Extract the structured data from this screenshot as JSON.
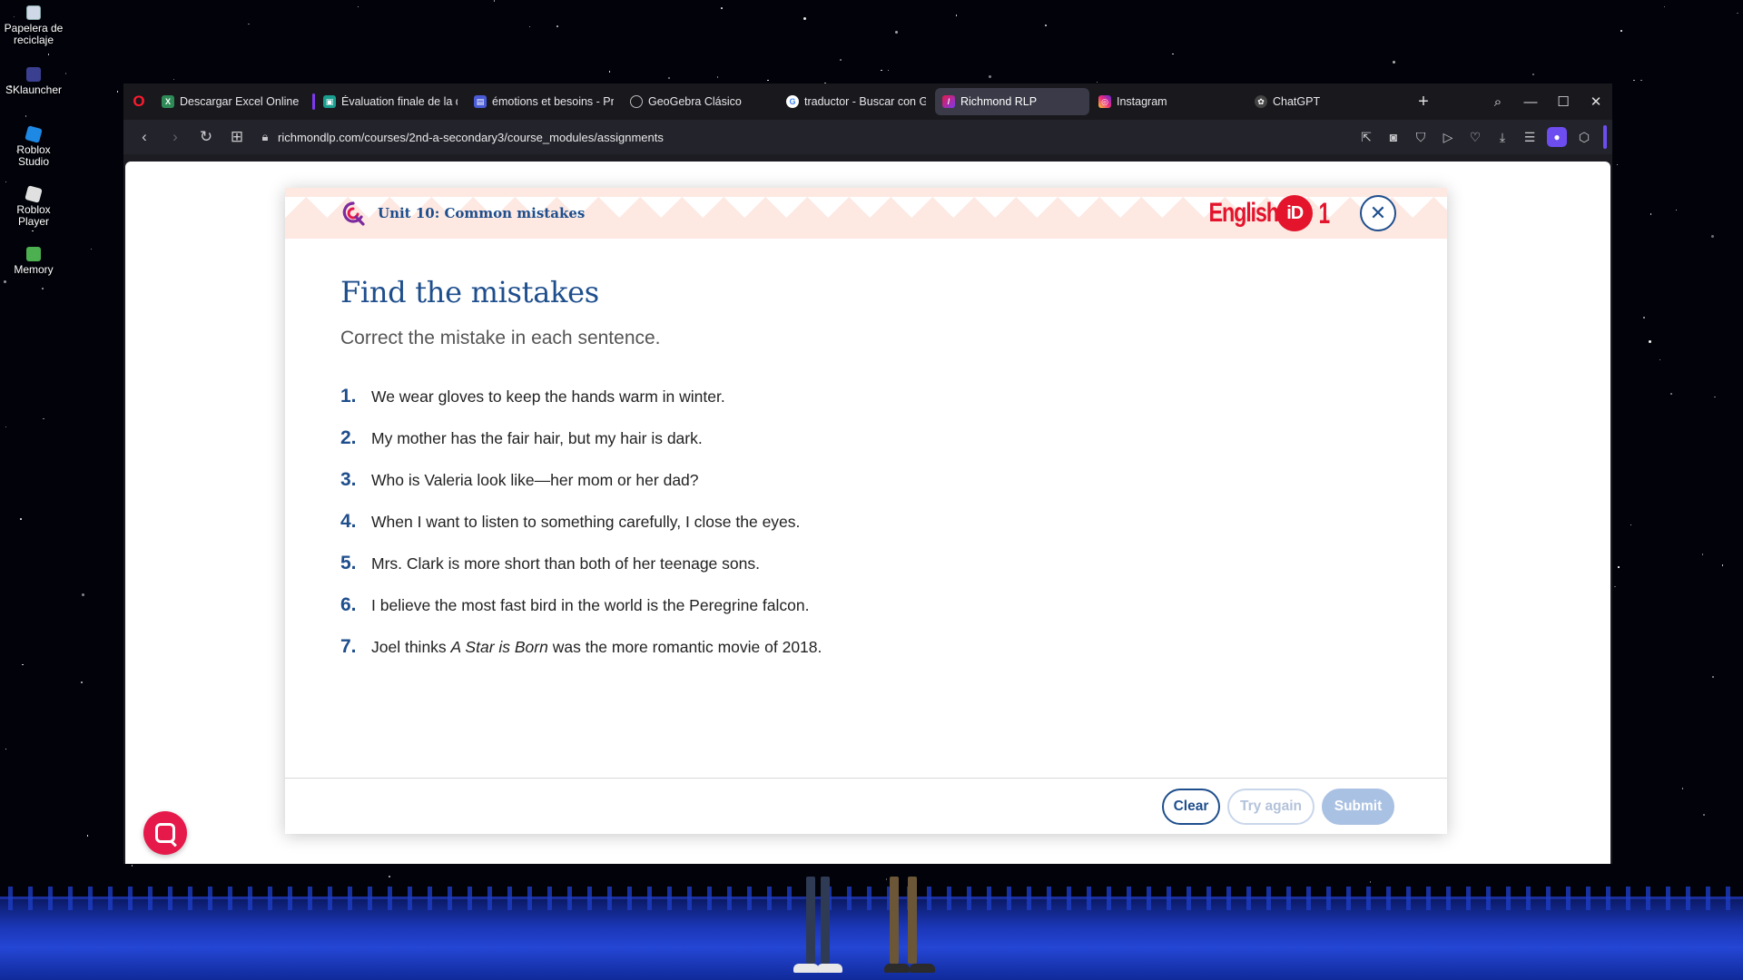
{
  "desktop": {
    "icons": [
      {
        "label": "Papelera de reciclaje",
        "icon": "recycle-bin-icon"
      },
      {
        "label": "SKlauncher",
        "icon": "sklauncher-icon"
      },
      {
        "label": "Roblox Studio",
        "icon": "roblox-studio-icon"
      },
      {
        "label": "Roblox Player",
        "icon": "roblox-player-icon"
      },
      {
        "label": "Memory",
        "icon": "memory-icon"
      }
    ]
  },
  "browser": {
    "tabs": [
      {
        "label": "Descargar Excel Online va",
        "favicon": "excel-download-icon",
        "color": "#2e8b57"
      },
      {
        "label": "Évaluation finale de la qua",
        "favicon": "classroom-icon",
        "color": "#1a73e8"
      },
      {
        "label": "émotions et besoins - Pre",
        "favicon": "slides-icon",
        "color": "#4a5bd6"
      },
      {
        "label": "GeoGebra Clásico",
        "favicon": "geogebra-icon",
        "color": "#666666"
      },
      {
        "label": "traductor - Buscar con Go",
        "favicon": "google-icon",
        "color": "#ffffff"
      },
      {
        "label": "Richmond RLP",
        "favicon": "richmond-icon",
        "color": "#e6194b",
        "active": true
      },
      {
        "label": "Instagram",
        "favicon": "instagram-icon",
        "color": "#d6249f"
      },
      {
        "label": "ChatGPT",
        "favicon": "chatgpt-icon",
        "color": "#444444"
      }
    ],
    "url": "richmondlp.com/courses/2nd-a-secondary3/course_modules/assignments"
  },
  "activity": {
    "unit_title": "Unit 10: Common mistakes",
    "brand": {
      "word": "English",
      "id": "iD",
      "level": "1"
    },
    "title": "Find the mistakes",
    "instructions": "Correct the mistake in each sentence.",
    "sentences": [
      {
        "num": "1.",
        "text": "We wear gloves to keep the hands warm in winter."
      },
      {
        "num": "2.",
        "text": "My mother has the fair hair, but my hair is dark."
      },
      {
        "num": "3.",
        "text": "Who is Valeria look like—her mom or her dad?"
      },
      {
        "num": "4.",
        "text": "When I want to listen to something carefully, I close the eyes."
      },
      {
        "num": "5.",
        "text": "Mrs. Clark is more short than both of her teenage sons."
      },
      {
        "num": "6.",
        "text": "I believe the most fast bird in the world is the Peregrine falcon."
      },
      {
        "num": "7.",
        "text_before": "Joel thinks ",
        "text_italic": "A Star is Born",
        "text_after": " was the more romantic movie of 2018."
      }
    ],
    "buttons": {
      "clear": "Clear",
      "try_again": "Try again",
      "submit": "Submit"
    }
  },
  "colors": {
    "accent": "#1e4e8c",
    "brand_red": "#e3142c",
    "fab": "#e6194b"
  }
}
